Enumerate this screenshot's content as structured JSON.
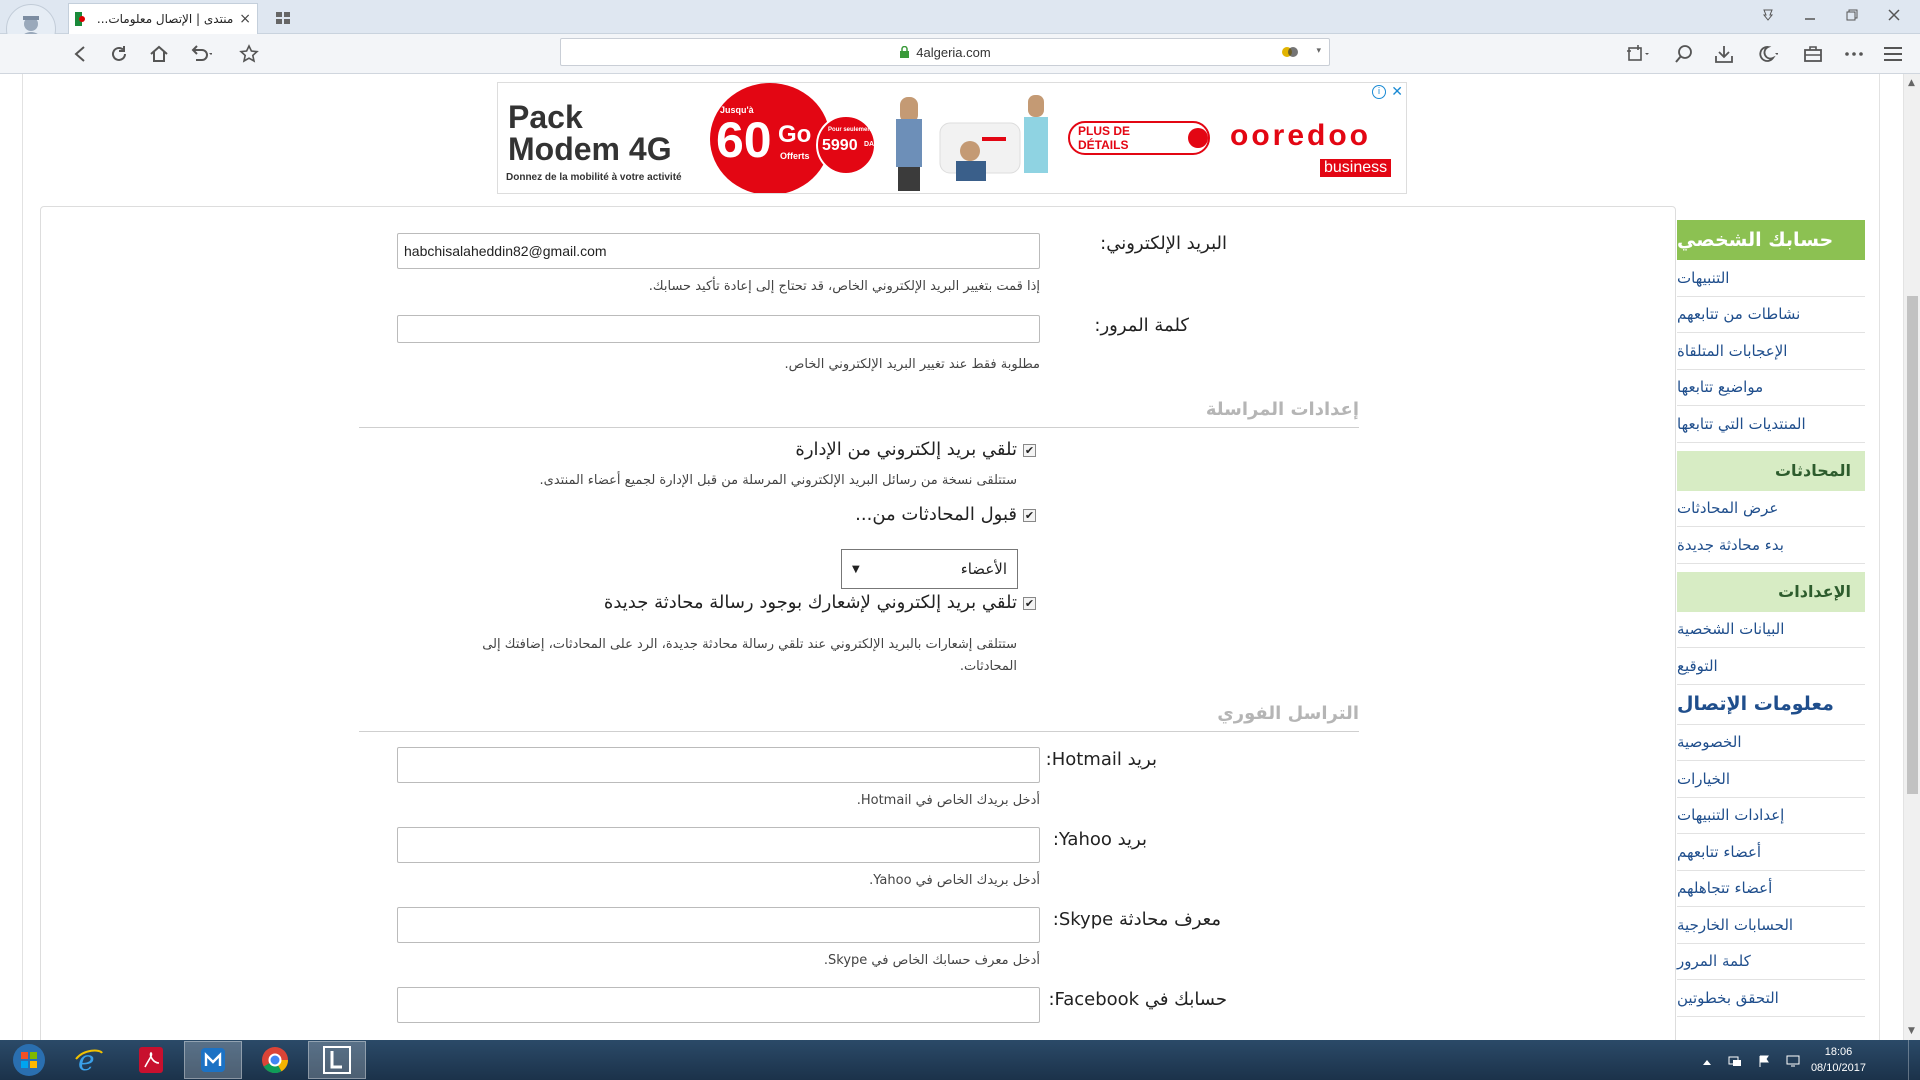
{
  "browser": {
    "tab_title": "منتدى | الإتصال معلومات...",
    "tab_close": "×",
    "url": "4algeria.com"
  },
  "ad": {
    "pack": "Pack",
    "modem": "Modem 4G",
    "jusqua": "Jusqu'à",
    "go_amount": "60",
    "go_unit": "Go",
    "offerts": "Offerts",
    "price_note": "Pour seulement",
    "price": "5990",
    "currency": "DA",
    "tagline": "Donnez de la mobilité à votre activité",
    "cta": "PLUS DE DÉTAILS",
    "brand": "ooredoo",
    "brand_sub": "business"
  },
  "form": {
    "email_label": "البريد الإلكتروني:",
    "email_value": "habchisalaheddin82@gmail.com",
    "email_hint": "إذا قمت بتغيير البريد الإلكتروني الخاص، قد تحتاج إلى إعادة تأكيد حسابك.",
    "password_label": "كلمة المرور:",
    "password_value": "",
    "password_hint": "مطلوبة فقط عند تغيير البريد الإلكتروني الخاص.",
    "section_mail": "إعدادات المراسلة",
    "chk_admin_label": "تلقي بريد إلكتروني من الإدارة",
    "chk_admin_hint": "ستتلقى نسخة من رسائل البريد الإلكتروني المرسلة من قبل الإدارة لجميع أعضاء المنتدى.",
    "chk_conv_label": "قبول المحادثات من...",
    "conv_select_value": "الأعضاء",
    "chk_notify_label": "تلقي بريد إلكتروني لإشعارك بوجود رسالة محادثة جديدة",
    "chk_notify_hint_1": "ستتلقى إشعارات بالبريد الإلكتروني عند تلقي رسالة محادثة جديدة، الرد على المحادثات، إضافتك إلى",
    "chk_notify_hint_2": "المحادثات.",
    "section_im": "التراسل الفوري",
    "hotmail_label": "بريد Hotmail:",
    "hotmail_hint": "أدخل بريدك الخاص في Hotmail.",
    "yahoo_label": "بريد Yahoo:",
    "yahoo_hint": "أدخل بريدك الخاص في Yahoo.",
    "skype_label": "معرف محادثة Skype:",
    "skype_hint": "أدخل معرف حسابك الخاص في Skype.",
    "facebook_label": "حسابك في Facebook:"
  },
  "sidebar": {
    "head": "حسابك الشخصي",
    "group1": [
      "التنبيهات",
      "نشاطات من تتابعهم",
      "الإعجابات المتلقاة",
      "مواضيع تتابعها",
      "المنتديات التي تتابعها"
    ],
    "conversations_head": "المحادثات",
    "group2": [
      "عرض المحادثات",
      "بدء محادثة جديدة"
    ],
    "settings_head": "الإعدادات",
    "group3": [
      "البيانات الشخصية",
      "التوقيع",
      "معلومات الإتصال",
      "الخصوصية",
      "الخيارات",
      "إعدادات التنبيهات",
      "أعضاء تتابعهم",
      "أعضاء تتجاهلهم",
      "الحسابات الخارجية",
      "كلمة المرور",
      "التحقق بخطوتين"
    ]
  },
  "taskbar": {
    "time": "18:06",
    "date": "08/10/2017"
  },
  "colors": {
    "sidebar_head": "#8cc152",
    "sidebar_sub": "#d7ecc4",
    "link": "#1f4e8c",
    "ad_red": "#e30613"
  }
}
